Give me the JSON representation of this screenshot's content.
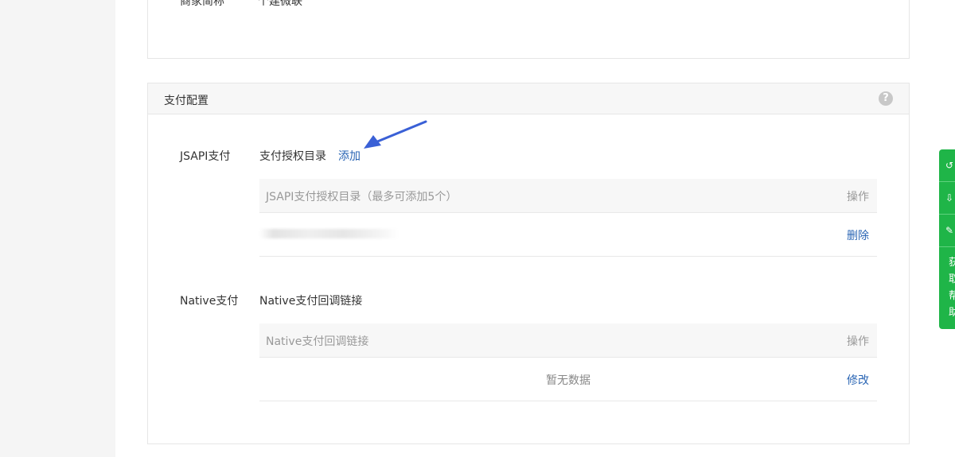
{
  "top_section": {
    "cut_label": "商家简称",
    "cut_value": "个建微联"
  },
  "payment_config": {
    "title": "支付配置",
    "help_icon": "?",
    "jsapi": {
      "label": "JSAPI支付",
      "dir_label": "支付授权目录",
      "add_link": "添加",
      "table_header": "JSAPI支付授权目录（最多可添加5个）",
      "table_action_header": "操作",
      "row_action": "删除"
    },
    "native": {
      "label": "Native支付",
      "callback_label": "Native支付回调链接",
      "table_header": "Native支付回调链接",
      "table_action_header": "操作",
      "empty_text": "暂无数据",
      "row_action": "修改"
    }
  },
  "float_tab": {
    "text": "获取帮助"
  },
  "colors": {
    "link": "#2a65b4",
    "float_tab": "#1fb548",
    "arrow": "#3a60d6"
  }
}
